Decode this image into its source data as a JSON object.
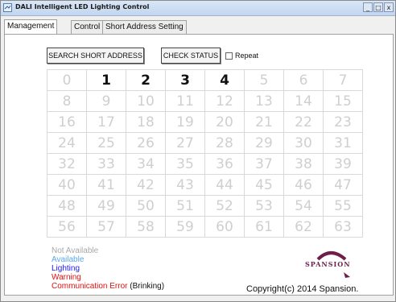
{
  "window": {
    "title": "DALI Intelligent LED Lighting Control",
    "controls": {
      "minimize": "_",
      "maximize": "□",
      "close": "x"
    }
  },
  "tabs": [
    {
      "label": "Management",
      "active": true
    },
    {
      "label": "Control",
      "active": false
    },
    {
      "label": "Short Address Setting",
      "active": false
    }
  ],
  "toolbar": {
    "search_label": "SEARCH SHORT ADDRESS",
    "check_label": "CHECK STATUS",
    "repeat_label": "Repeat",
    "repeat_checked": false
  },
  "grid": {
    "rows": [
      [
        "0",
        "1",
        "2",
        "3",
        "4",
        "5",
        "6",
        "7"
      ],
      [
        "8",
        "9",
        "10",
        "11",
        "12",
        "13",
        "14",
        "15"
      ],
      [
        "16",
        "17",
        "18",
        "19",
        "20",
        "21",
        "22",
        "23"
      ],
      [
        "24",
        "25",
        "26",
        "27",
        "28",
        "29",
        "30",
        "31"
      ],
      [
        "32",
        "33",
        "34",
        "35",
        "36",
        "37",
        "38",
        "39"
      ],
      [
        "40",
        "41",
        "42",
        "43",
        "44",
        "45",
        "46",
        "47"
      ],
      [
        "48",
        "49",
        "50",
        "51",
        "52",
        "53",
        "54",
        "55"
      ],
      [
        "56",
        "57",
        "58",
        "59",
        "60",
        "61",
        "62",
        "63"
      ]
    ],
    "available": [
      "1",
      "2",
      "3",
      "4"
    ]
  },
  "legend": {
    "not_available": "Not Available",
    "available": "Available",
    "lighting": "Lighting",
    "warning": "Warning",
    "comm_error": "Communication Error",
    "comm_error_note": "(Brinking)"
  },
  "colors": {
    "not_available": "#a8a8a8",
    "available": "#5aa7e8",
    "lighting": "#1a1aff",
    "warning": "#e01010",
    "comm_error": "#e01010",
    "logo": "#6d1e4a"
  },
  "logo_text": "SPANSION",
  "copyright": "Copyright(c) 2014 Spansion."
}
